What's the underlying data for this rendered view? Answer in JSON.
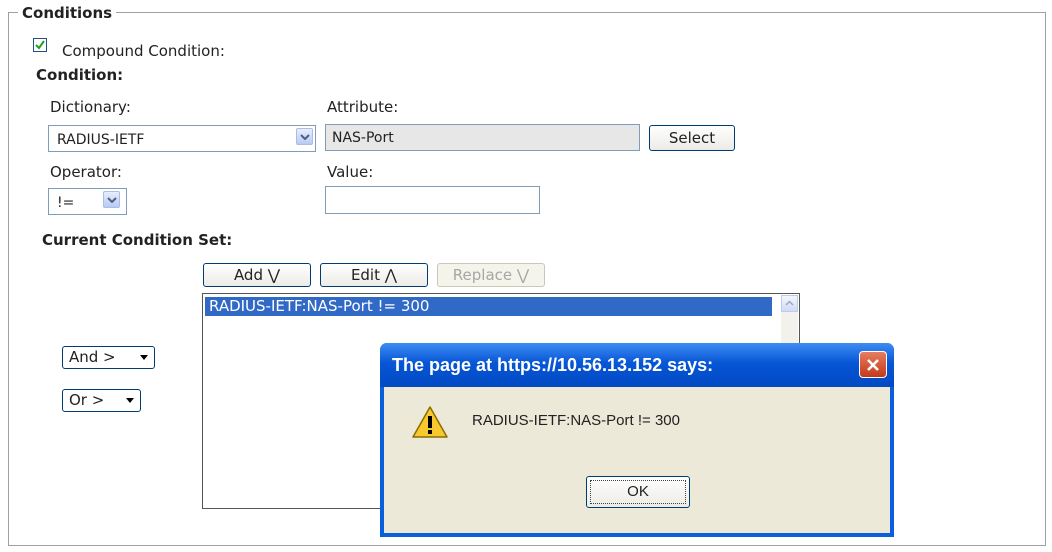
{
  "conditions": {
    "legend": "Conditions",
    "compound_label": "Compound Condition:",
    "compound_checked": true,
    "condition_heading": "Condition:",
    "dictionary_label": "Dictionary:",
    "dictionary_value": "RADIUS-IETF",
    "attribute_label": "Attribute:",
    "attribute_value": "NAS-Port",
    "select_button": "Select",
    "operator_label": "Operator:",
    "operator_value": "!=",
    "value_label": "Value:",
    "value_value": "",
    "current_set_heading": "Current Condition Set:",
    "add_button": "Add ⋁",
    "edit_button": "Edit ⋀",
    "replace_button": "Replace ⋁",
    "list_items": [
      "RADIUS-IETF:NAS-Port != 300"
    ],
    "and_select": "And >",
    "or_select": "Or >"
  },
  "dialog": {
    "title": "The page at https://10.56.13.152 says:",
    "message": "RADIUS-IETF:NAS-Port != 300",
    "ok_button": "OK"
  },
  "icons": {
    "checkbox": "checkmark-icon",
    "dropdown": "chevron-down-icon",
    "warning": "warning-icon",
    "close": "close-icon"
  },
  "colors": {
    "selection": "#3169c6",
    "dialog_title": "#0656d6",
    "dialog_body": "#ece9d8"
  }
}
